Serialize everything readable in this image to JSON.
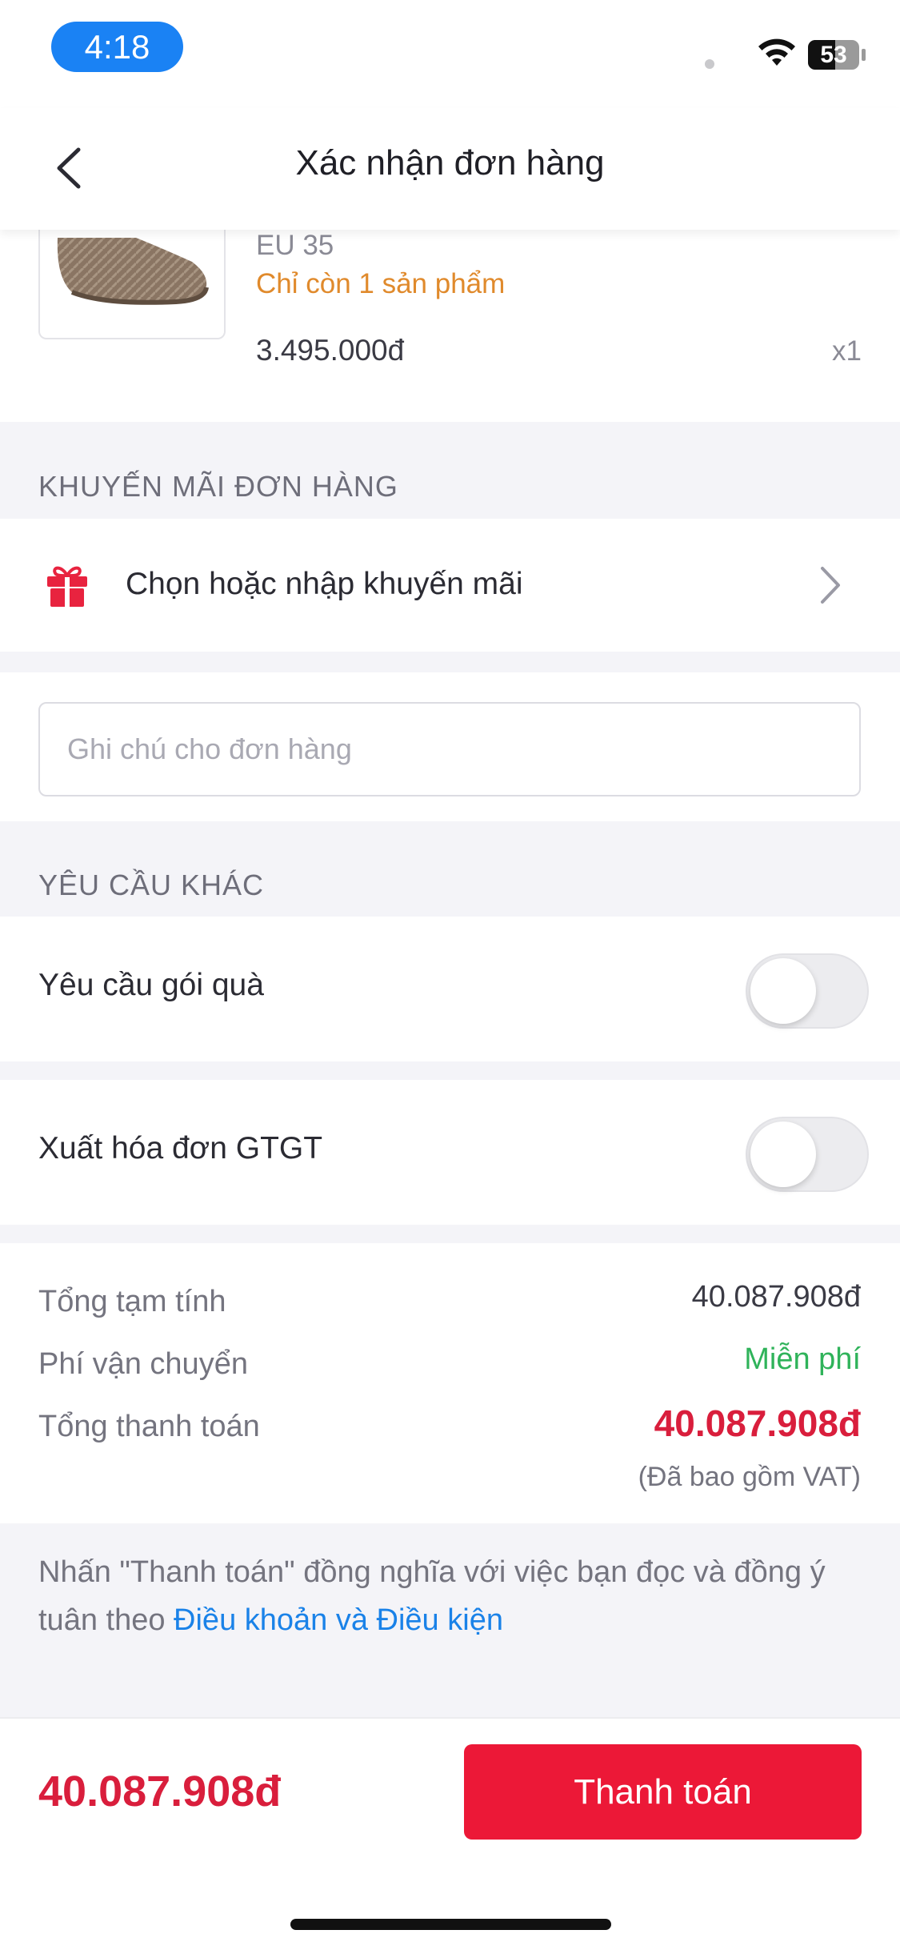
{
  "status_bar": {
    "time": "4:18",
    "battery_level": "53",
    "battery_fraction": 0.53
  },
  "header": {
    "title": "Xác nhận đơn hàng"
  },
  "product": {
    "size": "EU 35",
    "stock_note": "Chỉ còn 1 sản phẩm",
    "price": "3.495.000đ",
    "quantity": "x1"
  },
  "promotion": {
    "section_title": "KHUYẾN MÃI ĐƠN HÀNG",
    "select_label": "Chọn hoặc nhập khuyến mãi"
  },
  "note": {
    "placeholder": "Ghi chú cho đơn hàng",
    "value": ""
  },
  "other_requests": {
    "section_title": "YÊU CẦU KHÁC",
    "gift_wrap_label": "Yêu cầu gói quà",
    "gift_wrap_on": false,
    "vat_invoice_label": "Xuất hóa đơn GTGT",
    "vat_invoice_on": false
  },
  "summary": {
    "subtotal_label": "Tổng tạm tính",
    "subtotal_value": "40.087.908đ",
    "shipping_label": "Phí vận chuyển",
    "shipping_value": "Miễn phí",
    "total_label": "Tổng thanh toán",
    "total_value": "40.087.908đ",
    "vat_note": "(Đã bao gồm VAT)"
  },
  "terms": {
    "text": "Nhấn \"Thanh toán\" đồng nghĩa với việc bạn đọc và đồng ý tuân theo ",
    "link": "Điều khoản và Điều kiện"
  },
  "footer": {
    "total": "40.087.908đ",
    "pay_label": "Thanh toán"
  },
  "colors": {
    "accent_red": "#ec1837",
    "price_red": "#d91e3c",
    "free_green": "#2fb35a",
    "link_blue": "#1a82e8",
    "stock_orange": "#e08a2c",
    "time_pill_blue": "#1a82f4"
  }
}
